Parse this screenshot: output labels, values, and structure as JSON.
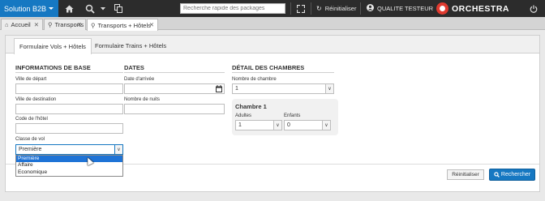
{
  "topbar": {
    "brand": "Solution B2B",
    "search_placeholder": "Recherche rapide des packages",
    "reset_label": "Réinitialiser",
    "user_label": "QUALITE TESTEUR",
    "logo_text": "ORCHESTRA",
    "icons": [
      "home-icon",
      "search-icon",
      "copy-icon",
      "expand-icon",
      "refresh-icon",
      "user-icon",
      "power-icon"
    ]
  },
  "window_tabs": [
    {
      "label": "Accueil",
      "icon": "home-icon"
    },
    {
      "label": "Transports",
      "icon": "search-icon"
    },
    {
      "label": "Transports + Hôtels",
      "icon": "search-icon",
      "active": true
    }
  ],
  "form_tabs": [
    {
      "label": "Formulaire Vols + Hôtels",
      "active": true
    },
    {
      "label": "Formulaire Trains + Hôtels"
    }
  ],
  "base_info": {
    "title": "INFORMATIONS DE BASE",
    "departure_label": "Ville de départ",
    "departure_value": "",
    "destination_label": "Ville de destination",
    "destination_value": "",
    "hotel_code_label": "Code de l'hôtel",
    "hotel_code_value": "",
    "flight_class_label": "Classe de vol",
    "flight_class_value": "Première",
    "flight_class_options": [
      "Première",
      "Affaire",
      "Economique"
    ]
  },
  "dates": {
    "title": "DATES",
    "arrival_label": "Date d'arrivée",
    "arrival_value": "",
    "nights_label": "Nombre de nuits",
    "nights_value": ""
  },
  "rooms": {
    "title": "DÉTAIL DES CHAMBRES",
    "count_label": "Nombre de chambre",
    "count_value": "1",
    "room_title": "Chambre 1",
    "adults_label": "Adultes",
    "adults_value": "1",
    "children_label": "Enfants",
    "children_value": "0"
  },
  "actions": {
    "reset_label": "Réinitialiser",
    "search_label": "Rechercher"
  },
  "colors": {
    "accent": "#1678c2",
    "topbar": "#2c2c2c",
    "logo": "#e03a2f",
    "selected_option": "#1e73d6"
  }
}
